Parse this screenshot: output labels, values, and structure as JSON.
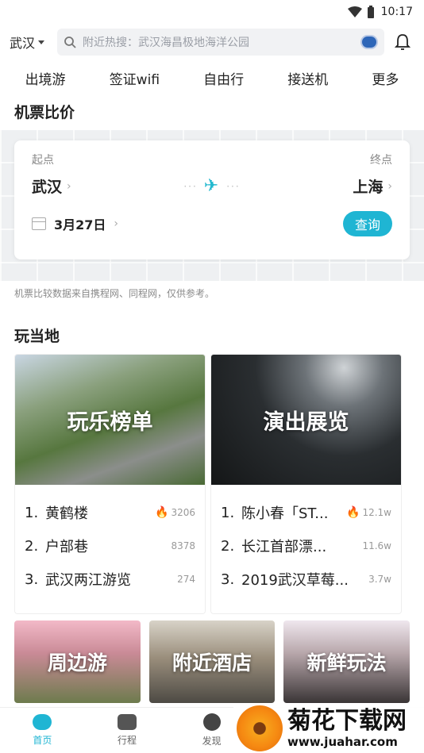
{
  "status": {
    "time": "10:17"
  },
  "header": {
    "city": "武汉",
    "search_placeholder": "附近热搜：武汉海昌极地海洋公园"
  },
  "nav": [
    "出境游",
    "签证wifi",
    "自由行",
    "接送机",
    "更多"
  ],
  "flight": {
    "section_title": "机票比价",
    "from_label": "起点",
    "to_label": "终点",
    "from_city": "武汉",
    "to_city": "上海",
    "date": "3月27日",
    "query_label": "查询",
    "note": "机票比较数据来自携程网、同程网，仅供参考。"
  },
  "play": {
    "section_title": "玩当地",
    "cards": [
      {
        "title": "玩乐榜单",
        "items": [
          {
            "num": "1.",
            "name": "黄鹤楼",
            "count": "3206",
            "hot": true
          },
          {
            "num": "2.",
            "name": "户部巷",
            "count": "8378",
            "hot": false
          },
          {
            "num": "3.",
            "name": "武汉两江游览",
            "count": "274",
            "hot": false
          }
        ]
      },
      {
        "title": "演出展览",
        "items": [
          {
            "num": "1.",
            "name": "陈小春「ST...",
            "count": "12.1w",
            "hot": true
          },
          {
            "num": "2.",
            "name": "长江首部漂...",
            "count": "11.6w",
            "hot": false
          },
          {
            "num": "3.",
            "name": "2019武汉草莓...",
            "count": "3.7w",
            "hot": false
          }
        ]
      }
    ],
    "small_cards": [
      "周边游",
      "附近酒店",
      "新鲜玩法"
    ]
  },
  "tabbar": {
    "tabs": [
      "首页",
      "行程",
      "发现"
    ]
  },
  "watermark": {
    "text": "菊花下载网",
    "url": "www.juahar.com"
  },
  "colors": {
    "accent": "#1fb5d3",
    "hot": "#f25a3a"
  }
}
